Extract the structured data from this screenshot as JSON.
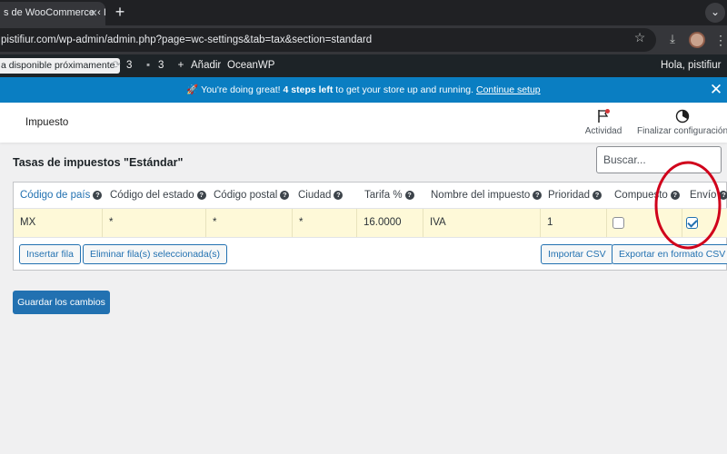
{
  "browser": {
    "tab_title": "s de WooCommerce ‹ I",
    "tab_close": "✕",
    "new_tab": "+",
    "url": "pistifiur.com/wp-admin/admin.php?page=wc-settings&tab=tax&section=standard"
  },
  "adminbar": {
    "site_label": "a disponible próximamente",
    "updates_count": "3",
    "comments_count": "3",
    "add_new": "Añadir",
    "theme": "OceanWP",
    "greeting": "Hola, pistifiur"
  },
  "notice": {
    "emoji": "🚀",
    "text_before": "You're doing great!",
    "bold": "4 steps left",
    "text_after": "to get your store up and running.",
    "link": "Continue setup"
  },
  "header": {
    "title": "Impuesto",
    "activity": "Actividad",
    "finish_setup": "Finalizar configuración"
  },
  "page": {
    "heading": "Tasas de impuestos \"Estándar\"",
    "search_placeholder": "Buscar..."
  },
  "table": {
    "columns": [
      "Código de país",
      "Código del estado",
      "Código postal",
      "Ciudad",
      "Tarifa %",
      "Nombre del impuesto",
      "Prioridad",
      "Compuesto",
      "Envío"
    ],
    "rows": [
      {
        "country": "MX",
        "state": "*",
        "postcode": "*",
        "city": "*",
        "rate": "16.0000",
        "name": "IVA",
        "priority": "1",
        "compound": false,
        "shipping": true
      }
    ]
  },
  "buttons": {
    "insert_row": "Insertar fila",
    "remove_rows": "Eliminar fila(s) seleccionada(s)",
    "import_csv": "Importar CSV",
    "export_csv": "Exportar en formato CSV",
    "save": "Guardar los cambios"
  },
  "colors": {
    "admin_bar": "#1d2327",
    "notice": "#0a7ec2",
    "primary": "#2271b1",
    "row_highlight": "#fef9d8",
    "annotation": "#d0021b"
  },
  "icons": {
    "refresh": "refresh-icon",
    "comment": "comment-icon",
    "plus": "plus-icon",
    "help": "help-icon"
  }
}
